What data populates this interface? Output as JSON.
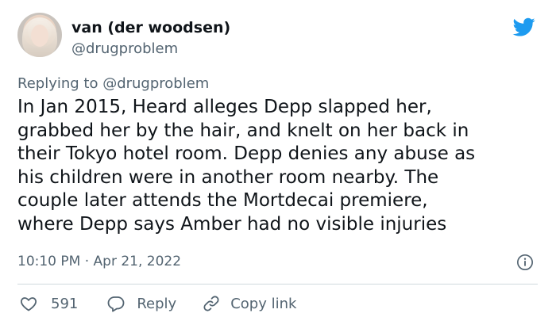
{
  "author": {
    "display_name": "van (der woodsen)",
    "handle": "@drugproblem"
  },
  "replying_to": "Replying to @drugproblem",
  "tweet": {
    "lines": [
      "In Jan 2015, Heard alleges Depp slapped her,",
      "grabbed her by the hair, and knelt on her back in",
      "their Tokyo hotel room. Depp denies any abuse as",
      "his children were in another room nearby. The",
      "couple later attends the Mortdecai premiere,",
      "where Depp says Amber had no visible injuries"
    ],
    "timestamp": "10:10 PM · Apr 21, 2022"
  },
  "actions": {
    "like_count": "591",
    "reply_label": "Reply",
    "copy_link_label": "Copy link"
  },
  "icons": {
    "platform": "twitter-bird-icon",
    "info": "info-icon",
    "like": "heart-icon",
    "reply": "reply-bubble-icon",
    "copy": "link-icon"
  },
  "colors": {
    "brand": "#1d9bf0",
    "text": "#0f1419",
    "muted": "#536471",
    "divider": "#cfd9de"
  }
}
